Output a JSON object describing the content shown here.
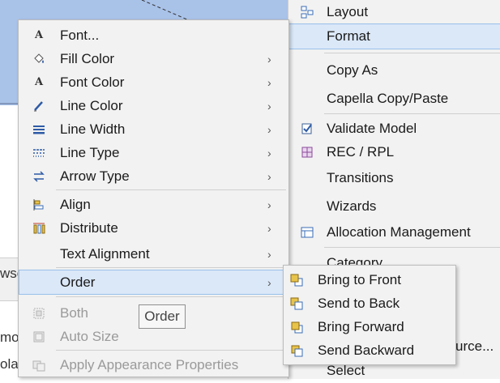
{
  "background": {
    "fragments": [
      "wse",
      "mo",
      "ola"
    ]
  },
  "main_menu": {
    "items": [
      {
        "label": "Layout",
        "icon": "layout-icon"
      },
      {
        "label": "Format",
        "icon": "",
        "highlighted": true
      },
      {
        "label": "Copy As",
        "icon": ""
      },
      {
        "label": "Capella Copy/Paste",
        "icon": ""
      },
      {
        "label": "Validate Model",
        "icon": "validate-icon"
      },
      {
        "label": "REC / RPL",
        "icon": "rec-rpl-icon"
      },
      {
        "label": "Transitions",
        "icon": ""
      },
      {
        "label": "Wizards",
        "icon": ""
      },
      {
        "label": "Allocation Management",
        "icon": "allocation-icon"
      },
      {
        "label": "Category",
        "icon": ""
      },
      {
        "label": "urce...",
        "icon": ""
      },
      {
        "label": "Select",
        "icon": ""
      }
    ]
  },
  "format_menu": {
    "items": [
      {
        "label": "Font...",
        "icon": "font-icon",
        "submenu": false
      },
      {
        "label": "Fill Color",
        "icon": "fill-color-icon",
        "submenu": true
      },
      {
        "label": "Font Color",
        "icon": "font-color-icon",
        "submenu": true
      },
      {
        "label": "Line Color",
        "icon": "line-color-icon",
        "submenu": true
      },
      {
        "label": "Line Width",
        "icon": "line-width-icon",
        "submenu": true
      },
      {
        "label": "Line Type",
        "icon": "line-type-icon",
        "submenu": true
      },
      {
        "label": "Arrow Type",
        "icon": "arrow-type-icon",
        "submenu": true
      },
      {
        "label": "Align",
        "icon": "align-icon",
        "submenu": true
      },
      {
        "label": "Distribute",
        "icon": "distribute-icon",
        "submenu": true
      },
      {
        "label": "Text Alignment",
        "icon": "",
        "submenu": true
      },
      {
        "label": "Order",
        "icon": "",
        "submenu": true,
        "highlighted": true
      },
      {
        "label": "Both",
        "icon": "both-size-icon",
        "disabled": true
      },
      {
        "label": "Auto Size",
        "icon": "auto-size-icon",
        "disabled": true
      },
      {
        "label": "Apply Appearance Properties",
        "icon": "apply-appearance-icon",
        "disabled": true
      }
    ],
    "submenu_arrow": "›"
  },
  "order_menu": {
    "items": [
      {
        "label": "Bring to Front",
        "icon": "bring-to-front-icon"
      },
      {
        "label": "Send to Back",
        "icon": "send-to-back-icon"
      },
      {
        "label": "Bring Forward",
        "icon": "bring-forward-icon"
      },
      {
        "label": "Send Backward",
        "icon": "send-backward-icon"
      }
    ]
  },
  "tooltip": {
    "text": "Order"
  },
  "colors": {
    "highlight": "#dbe8f8",
    "highlight_border": "#99c0ea",
    "canvas": "#a9c2e8",
    "icon_blue": "#2d5aa6",
    "icon_yellow": "#e8c34a"
  }
}
